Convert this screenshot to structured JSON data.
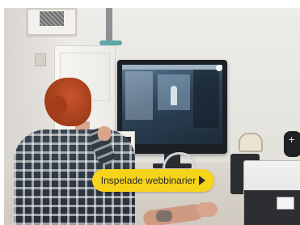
{
  "promo": {
    "cta_label": "Inspelade webbinarier",
    "cta_icon": "play-arrow-icon",
    "cta_color": "#f5d41a"
  }
}
